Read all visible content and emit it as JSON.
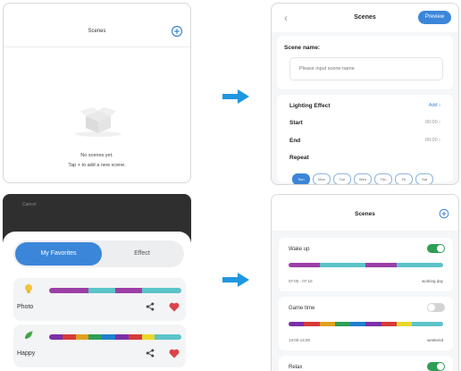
{
  "colors": {
    "accent": "#3b86d9",
    "toggle_on": "#2e9e57",
    "toggle_off": "#d3d3d3",
    "heart": "#d9434b",
    "arrow": "#1f97e0"
  },
  "panel1": {
    "title": "Scenes",
    "add_icon": "add-circle-icon",
    "empty_line1": "No scenes yet.",
    "empty_line2": "Tap + to add a new scene."
  },
  "panel2": {
    "title": "Scenes",
    "back_icon": "chevron-left-icon",
    "preview_label": "Preview",
    "scene_name_label": "Scene name:",
    "scene_name_placeholder": "Please input scene name",
    "rows": [
      {
        "label": "Lighting Effect",
        "value": "Add"
      },
      {
        "label": "Start",
        "value": "00:00"
      },
      {
        "label": "End",
        "value": "00:00"
      },
      {
        "label": "Repeat",
        "value": ""
      }
    ],
    "days": [
      "Sun",
      "Mon",
      "Tue",
      "Wed",
      "Thu",
      "Fri",
      "Sat"
    ],
    "selected_day": "Sun"
  },
  "panel3": {
    "header_label": "Cancel",
    "tabs": [
      "My Favorites",
      "Effect"
    ],
    "active_tab": "My Favorites",
    "favorites": [
      {
        "name": "Photo",
        "icon": "bulb-icon",
        "colors": [
          "#9b3fa6",
          "#9b3fa6",
          "#9b3fa6",
          "#5cc3c8",
          "#5cc3c8",
          "#9b3fa6",
          "#9b3fa6",
          "#5cc3c8",
          "#5cc3c8",
          "#5cc3c8"
        ]
      },
      {
        "name": "Happy",
        "icon": "leaf-icon",
        "colors": [
          "#7b2fa8",
          "#d63a3a",
          "#e0a020",
          "#2e9e57",
          "#1f7fd0",
          "#7b2fa8",
          "#d63a3a",
          "#e8d82a",
          "#5cc3c8",
          "#5cc3c8"
        ]
      }
    ]
  },
  "panel4": {
    "title": "Scenes",
    "plus_icon": "plus-circle-icon",
    "scenes": [
      {
        "name": "Wake up",
        "enabled": true,
        "time": "07:00 - 07:10",
        "tag": "working day",
        "colors": [
          "#9b3fa6",
          "#9b3fa6",
          "#5cc3c8",
          "#5cc3c8",
          "#5cc3c8",
          "#9b3fa6",
          "#9b3fa6",
          "#5cc3c8",
          "#5cc3c8",
          "#5cc3c8"
        ]
      },
      {
        "name": "Game time",
        "enabled": false,
        "time": "13:00-14:00",
        "tag": "weekend",
        "colors": [
          "#7b2fa8",
          "#d63a3a",
          "#e0a020",
          "#2e9e57",
          "#1f7fd0",
          "#7b2fa8",
          "#d63a3a",
          "#e8d82a",
          "#5cc3c8",
          "#5cc3c8"
        ]
      },
      {
        "name": "Relax",
        "enabled": true,
        "time": "",
        "tag": "",
        "colors": []
      }
    ]
  }
}
